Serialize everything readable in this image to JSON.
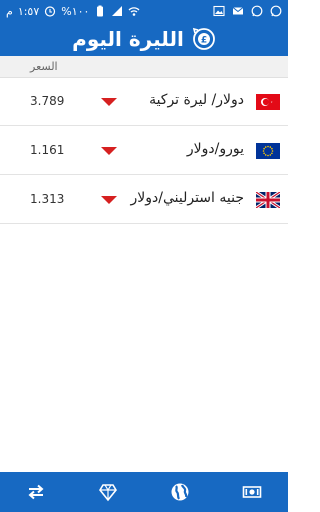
{
  "status_bar": {
    "time": "١:٥٧",
    "period": "م",
    "battery": "%١٠٠"
  },
  "header": {
    "title": "الليرة اليوم"
  },
  "table": {
    "column_price": "السعر",
    "rows": [
      {
        "pair": "دولار/ ليرة تركية",
        "value": "3.789",
        "trend": "down",
        "flag": "turkey-flag"
      },
      {
        "pair": "يورو/دولار",
        "value": "1.161",
        "trend": "down",
        "flag": "eu-flag"
      },
      {
        "pair": "جنيه استرليني/دولار",
        "value": "1.313",
        "trend": "down",
        "flag": "uk-flag"
      }
    ]
  },
  "bottom_nav": {
    "items": [
      "exchange-arrows-icon",
      "diamond-icon",
      "globe-icon",
      "banknote-icon"
    ],
    "active": "globe-icon"
  },
  "colors": {
    "primary": "#1769c2",
    "down_arrow": "#d62020",
    "header_bg": "#f1f1f1"
  }
}
